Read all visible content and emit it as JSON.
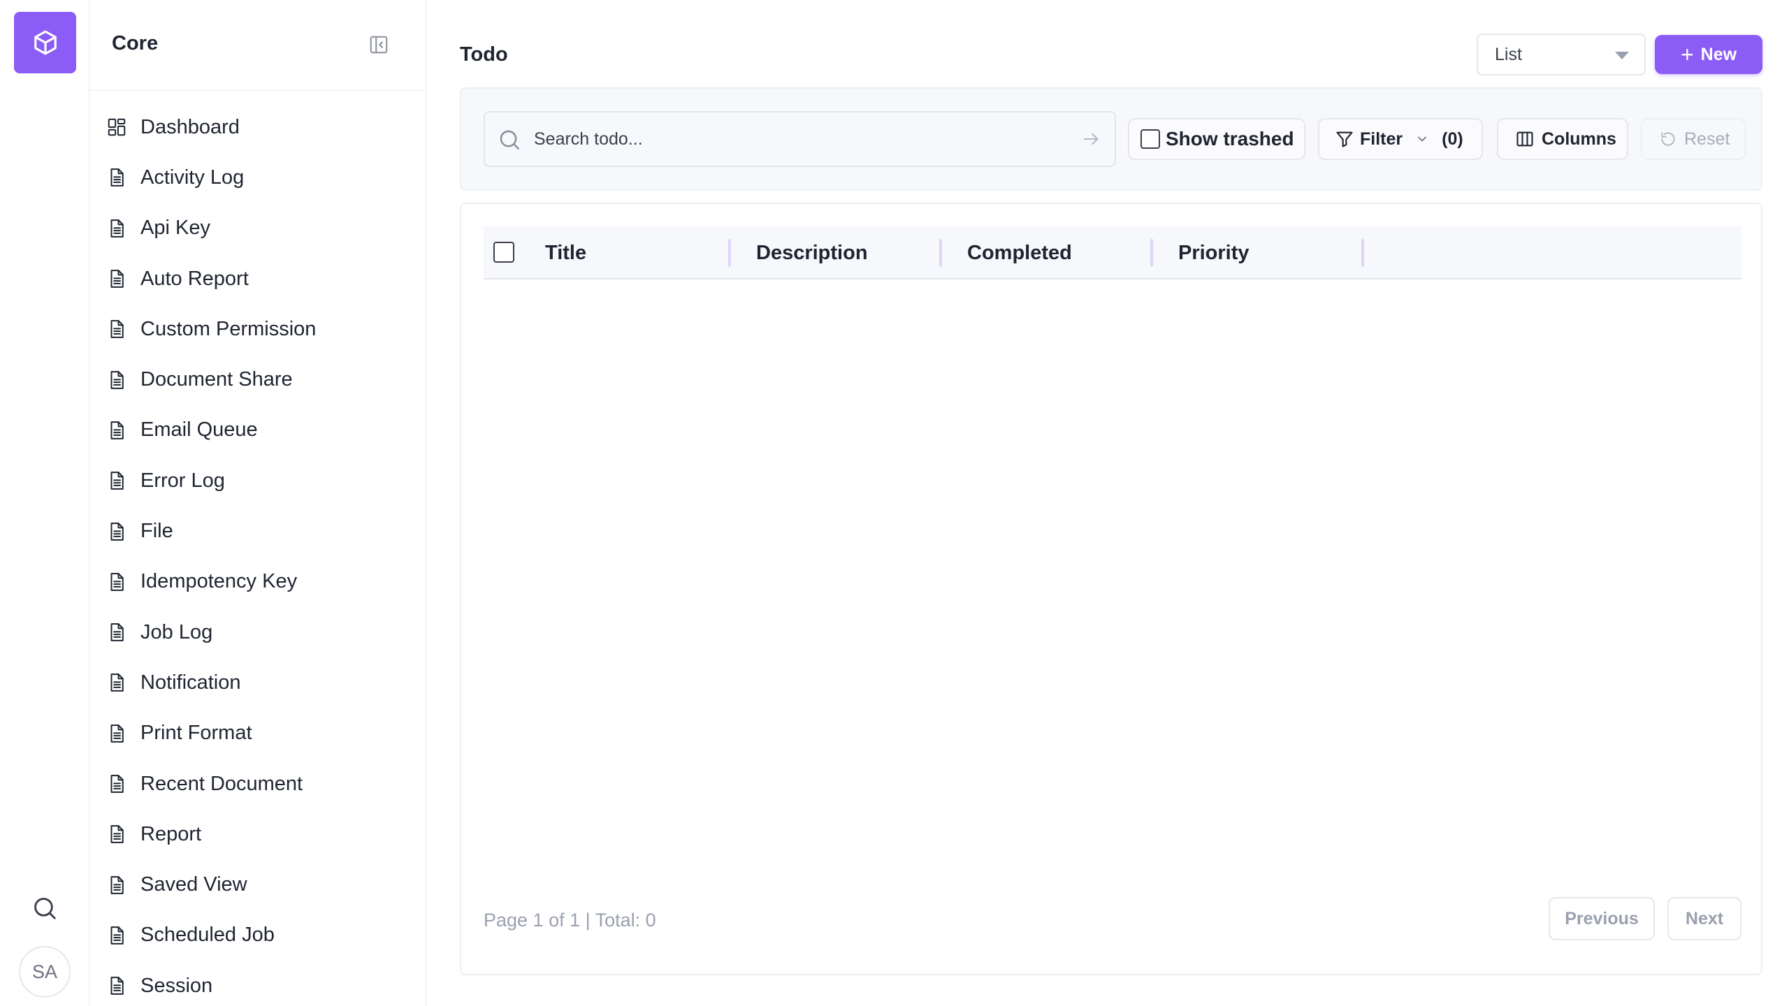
{
  "app": {
    "avatar_initials": "SA",
    "accent_color": "#8b5cf6"
  },
  "sidebar": {
    "title": "Core",
    "items": [
      {
        "label": "Dashboard",
        "icon": "dashboard-icon"
      },
      {
        "label": "Activity Log",
        "icon": "document-icon"
      },
      {
        "label": "Api Key",
        "icon": "document-icon"
      },
      {
        "label": "Auto Report",
        "icon": "document-icon"
      },
      {
        "label": "Custom Permission",
        "icon": "document-icon"
      },
      {
        "label": "Document Share",
        "icon": "document-icon"
      },
      {
        "label": "Email Queue",
        "icon": "document-icon"
      },
      {
        "label": "Error Log",
        "icon": "document-icon"
      },
      {
        "label": "File",
        "icon": "document-icon"
      },
      {
        "label": "Idempotency Key",
        "icon": "document-icon"
      },
      {
        "label": "Job Log",
        "icon": "document-icon"
      },
      {
        "label": "Notification",
        "icon": "document-icon"
      },
      {
        "label": "Print Format",
        "icon": "document-icon"
      },
      {
        "label": "Recent Document",
        "icon": "document-icon"
      },
      {
        "label": "Report",
        "icon": "document-icon"
      },
      {
        "label": "Saved View",
        "icon": "document-icon"
      },
      {
        "label": "Scheduled Job",
        "icon": "document-icon"
      },
      {
        "label": "Session",
        "icon": "document-icon"
      }
    ]
  },
  "header": {
    "title": "Todo",
    "view_select": "List",
    "new_label": "New"
  },
  "toolbar": {
    "search_placeholder": "Search todo...",
    "show_trashed_label": "Show trashed",
    "filter_label": "Filter",
    "filter_count": "(0)",
    "columns_label": "Columns",
    "reset_label": "Reset"
  },
  "table": {
    "columns": [
      "Title",
      "Description",
      "Completed",
      "Priority"
    ],
    "rows": []
  },
  "pagination": {
    "info": "Page 1 of 1 | Total: 0",
    "previous_label": "Previous",
    "next_label": "Next"
  }
}
